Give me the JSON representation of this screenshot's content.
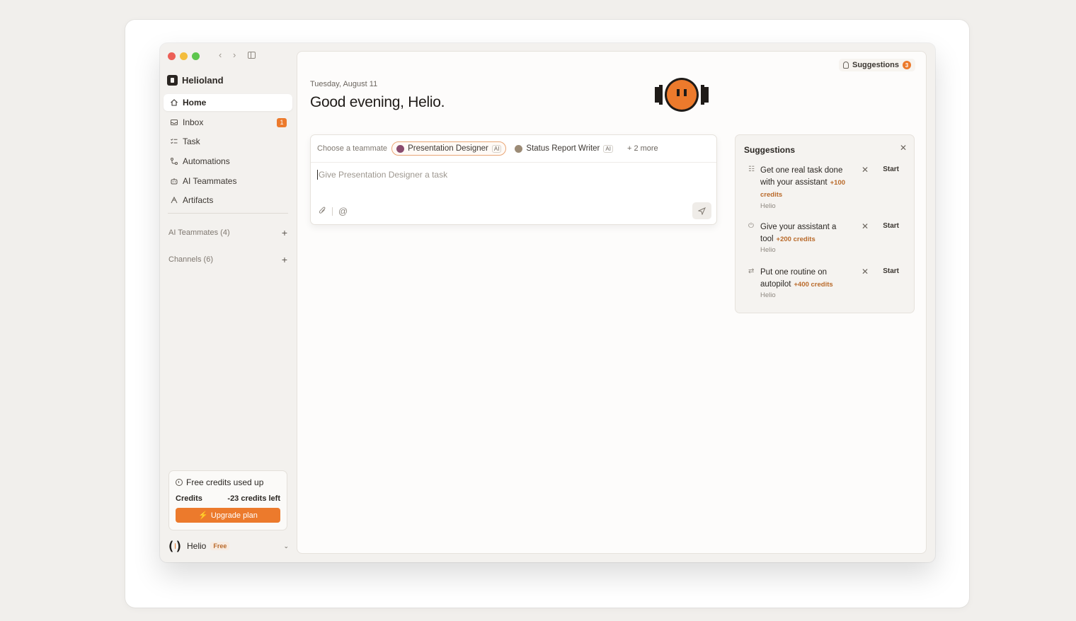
{
  "workspace": {
    "name": "Helioland"
  },
  "sidebar": {
    "items": [
      {
        "label": "Home",
        "icon": "home-icon"
      },
      {
        "label": "Inbox",
        "icon": "inbox-icon",
        "badge": "1"
      },
      {
        "label": "Task",
        "icon": "task-list-icon"
      },
      {
        "label": "Automations",
        "icon": "automation-icon"
      },
      {
        "label": "AI Teammates",
        "icon": "robot-icon"
      },
      {
        "label": "Artifacts",
        "icon": "artifact-icon"
      }
    ],
    "sections": [
      {
        "label": "AI Teammates (4)"
      },
      {
        "label": "Channels (6)"
      }
    ]
  },
  "credits": {
    "title": "Free credits used up",
    "label": "Credits",
    "value": "-23 credits left",
    "upgrade_label": "Upgrade plan"
  },
  "profile": {
    "name": "Helio",
    "plan": "Free"
  },
  "header": {
    "suggestions_label": "Suggestions",
    "suggestions_count": "3",
    "date": "Tuesday, August 11",
    "greeting": "Good evening, Helio."
  },
  "composer": {
    "choose_label": "Choose a teammate",
    "teammates": [
      {
        "name": "Presentation Designer",
        "tag": "AI"
      },
      {
        "name": "Status Report Writer",
        "tag": "AI"
      }
    ],
    "more_label": "2 more",
    "placeholder": "Give Presentation Designer a task"
  },
  "suggestions": {
    "title": "Suggestions",
    "items": [
      {
        "text": "Get one real task done with your assistant",
        "credits": "+100 credits",
        "owner": "Helio",
        "start": "Start"
      },
      {
        "text": "Give your assistant a tool",
        "credits": "+200 credits",
        "owner": "Helio",
        "start": "Start"
      },
      {
        "text": "Put one routine on autopilot",
        "credits": "+400 credits",
        "owner": "Helio",
        "start": "Start"
      }
    ]
  },
  "colors": {
    "accent": "#ec7a2c",
    "background": "#f1efec"
  }
}
